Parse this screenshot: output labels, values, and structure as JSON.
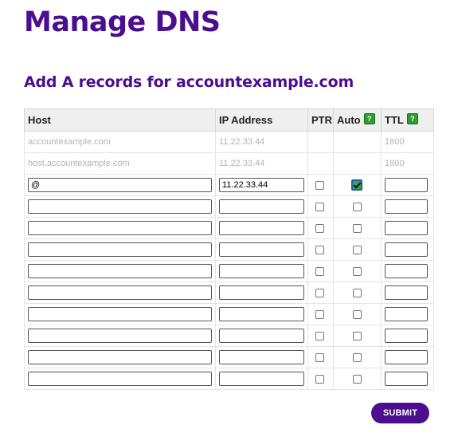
{
  "page": {
    "title": "Manage DNS",
    "section_title": "Add A records for accountexample.com"
  },
  "table": {
    "headers": {
      "host": "Host",
      "ip": "IP Address",
      "ptr": "PTR",
      "auto": "Auto",
      "ttl": "TTL"
    },
    "help_icon": "help-icon",
    "existing_records": [
      {
        "host": "accountexample.com",
        "ip": "11.22.33.44",
        "ttl": "1800"
      },
      {
        "host": "host.accountexample.com",
        "ip": "11.22.33.44",
        "ttl": "1800"
      }
    ],
    "edit_rows": [
      {
        "host": "@",
        "ip": "11.22.33.44",
        "ptr": false,
        "auto": true,
        "ttl": ""
      },
      {
        "host": "",
        "ip": "",
        "ptr": false,
        "auto": false,
        "ttl": ""
      },
      {
        "host": "",
        "ip": "",
        "ptr": false,
        "auto": false,
        "ttl": ""
      },
      {
        "host": "",
        "ip": "",
        "ptr": false,
        "auto": false,
        "ttl": ""
      },
      {
        "host": "",
        "ip": "",
        "ptr": false,
        "auto": false,
        "ttl": ""
      },
      {
        "host": "",
        "ip": "",
        "ptr": false,
        "auto": false,
        "ttl": ""
      },
      {
        "host": "",
        "ip": "",
        "ptr": false,
        "auto": false,
        "ttl": ""
      },
      {
        "host": "",
        "ip": "",
        "ptr": false,
        "auto": false,
        "ttl": ""
      },
      {
        "host": "",
        "ip": "",
        "ptr": false,
        "auto": false,
        "ttl": ""
      },
      {
        "host": "",
        "ip": "",
        "ptr": false,
        "auto": false,
        "ttl": ""
      }
    ]
  },
  "submit_label": "SUBMIT",
  "colors": {
    "brand": "#4a0e8f",
    "auto_checked": "#3fa33f",
    "help_icon": "#2f9e2f"
  }
}
